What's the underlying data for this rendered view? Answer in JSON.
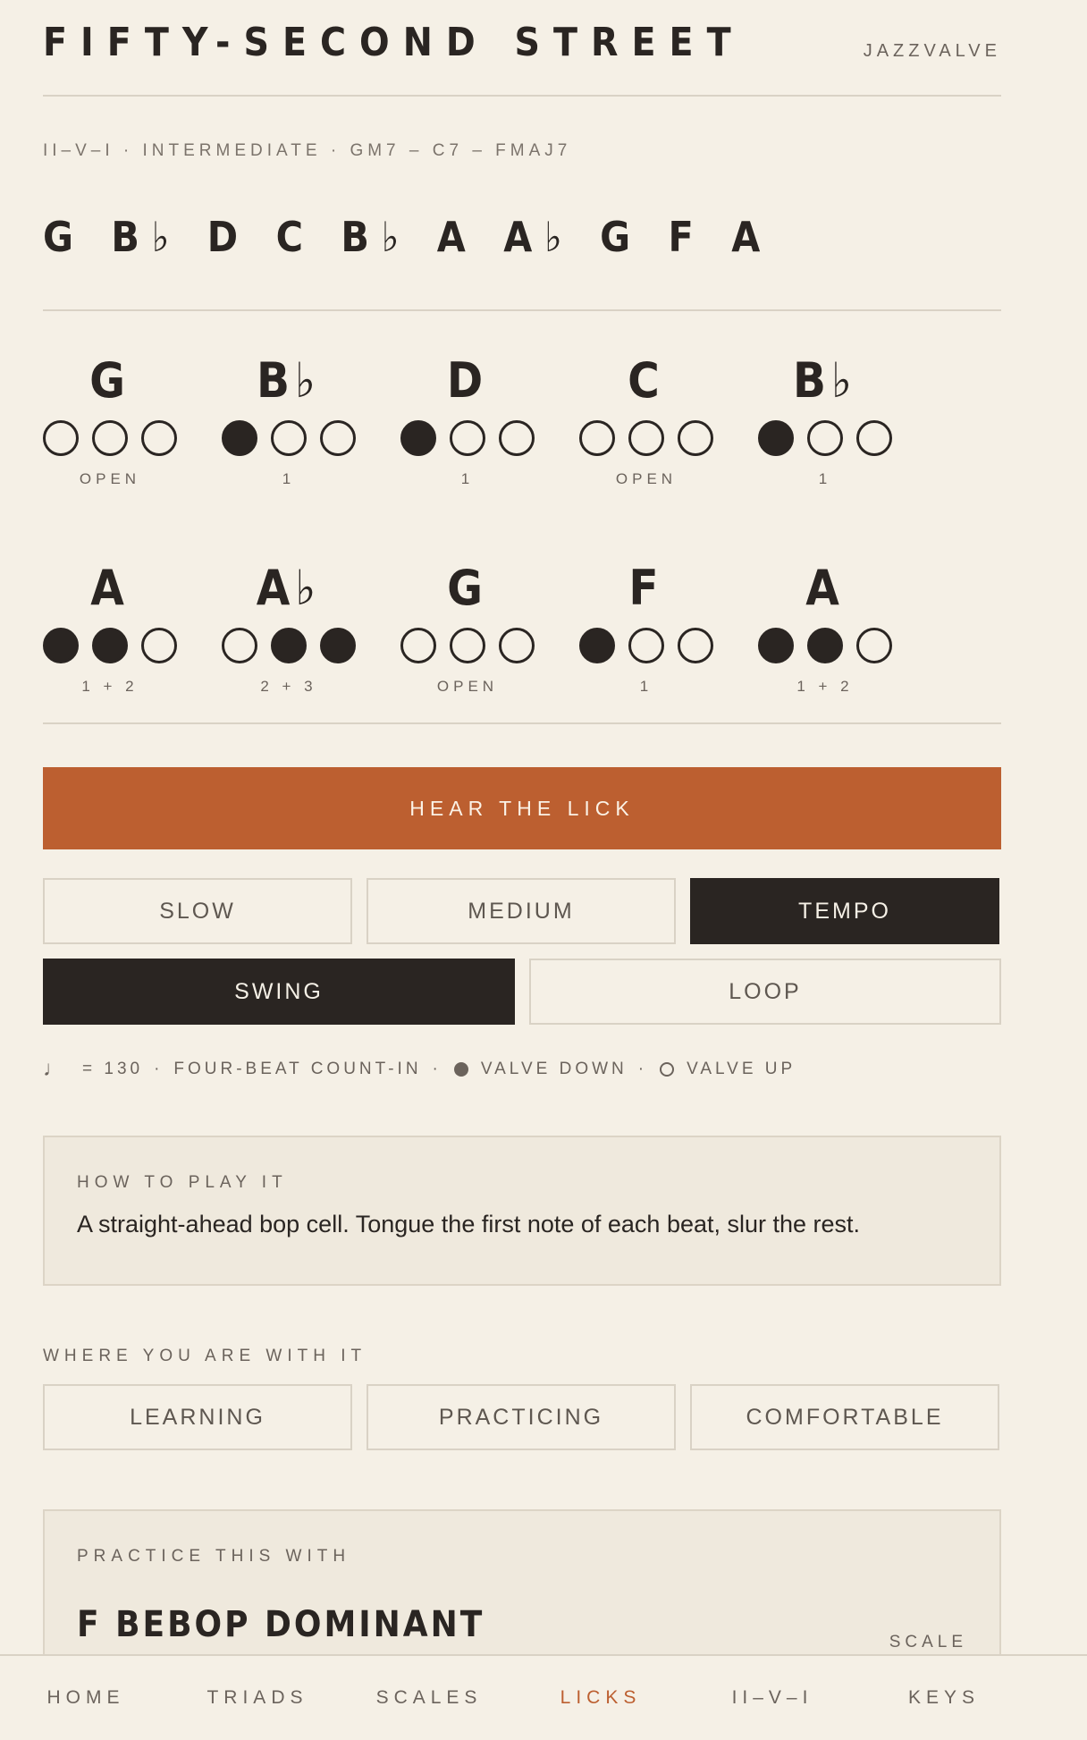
{
  "header": {
    "title": "FIFTY-SECOND STREET",
    "brand": "JAZZVALVE"
  },
  "lick": {
    "meta": "II–V–I · INTERMEDIATE · GM7 – C7 – FMAJ7",
    "sequence": "G B♭ D C B♭ A A♭ G F A"
  },
  "notes": [
    {
      "note": "G",
      "fingering": "OPEN",
      "valves": [
        false,
        false,
        false
      ]
    },
    {
      "note": "B♭",
      "fingering": "1",
      "valves": [
        true,
        false,
        false
      ]
    },
    {
      "note": "D",
      "fingering": "1",
      "valves": [
        true,
        false,
        false
      ]
    },
    {
      "note": "C",
      "fingering": "OPEN",
      "valves": [
        false,
        false,
        false
      ]
    },
    {
      "note": "B♭",
      "fingering": "1",
      "valves": [
        true,
        false,
        false
      ]
    },
    {
      "note": "A",
      "fingering": "1 + 2",
      "valves": [
        true,
        true,
        false
      ]
    },
    {
      "note": "A♭",
      "fingering": "2 + 3",
      "valves": [
        false,
        true,
        true
      ]
    },
    {
      "note": "G",
      "fingering": "OPEN",
      "valves": [
        false,
        false,
        false
      ]
    },
    {
      "note": "F",
      "fingering": "1",
      "valves": [
        true,
        false,
        false
      ]
    },
    {
      "note": "A",
      "fingering": "1 + 2",
      "valves": [
        true,
        true,
        false
      ]
    }
  ],
  "controls": {
    "hear": "HEAR THE LICK",
    "slow": "SLOW",
    "medium": "MEDIUM",
    "tempo": "TEMPO",
    "swing": "SWING",
    "loop": "LOOP"
  },
  "legend": {
    "note_icon": "♩",
    "tempo": "= 130",
    "count_in": "FOUR-BEAT COUNT-IN",
    "valve_down": "VALVE DOWN",
    "valve_up": "VALVE UP"
  },
  "howto": {
    "label": "HOW TO PLAY IT",
    "text": "A straight-ahead bop cell. Tongue the first note of each beat, slur the rest."
  },
  "status": {
    "label": "WHERE YOU ARE WITH IT",
    "learning": "LEARNING",
    "practicing": "PRACTICING",
    "comfortable": "COMFORTABLE"
  },
  "practice": {
    "label": "PRACTICE THIS WITH",
    "scale": "F BEBOP DOMINANT",
    "tag": "SCALE"
  },
  "nav": {
    "home": "HOME",
    "triads": "TRIADS",
    "scales": "SCALES",
    "licks": "LICKS",
    "iivi": "II–V–I",
    "keys": "KEYS"
  },
  "colors": {
    "accent": "#bc5f30",
    "dark": "#2a2522",
    "background": "#f5f0e6"
  }
}
